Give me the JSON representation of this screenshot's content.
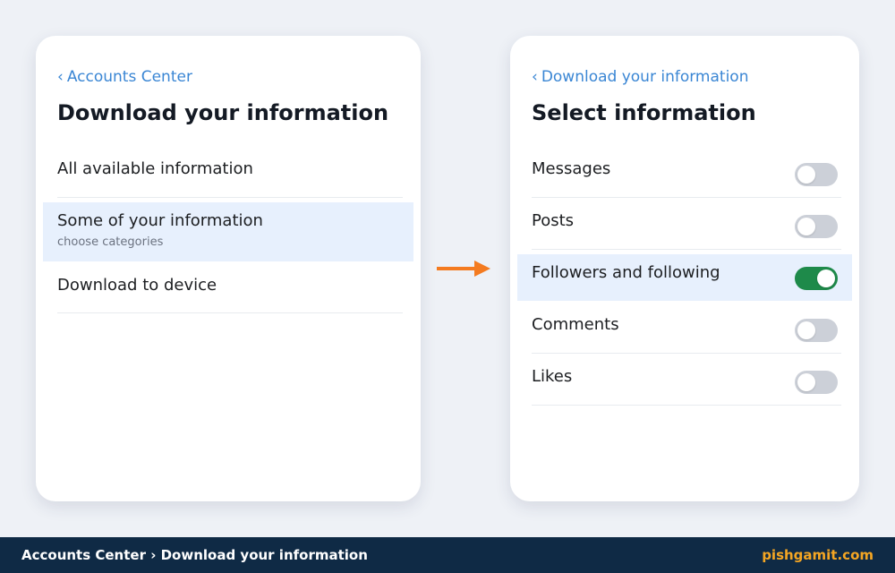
{
  "left_panel": {
    "back_label": "Accounts Center",
    "title": "Download your information",
    "options": [
      {
        "label": "All available information",
        "sub": "",
        "selected": false
      },
      {
        "label": "Some of your information",
        "sub": "choose categories",
        "selected": true
      },
      {
        "label": "Download to device",
        "sub": "",
        "selected": false
      }
    ]
  },
  "right_panel": {
    "back_label": "Download your information",
    "title": "Select information",
    "items": [
      {
        "label": "Messages",
        "enabled": false
      },
      {
        "label": "Posts",
        "enabled": false
      },
      {
        "label": "Followers and following",
        "enabled": true
      },
      {
        "label": "Comments",
        "enabled": false
      },
      {
        "label": "Likes",
        "enabled": false
      }
    ]
  },
  "arrow": {
    "icon": "arrow-right-icon",
    "color": "#f47b20"
  },
  "footer": {
    "breadcrumb": "Accounts Center › Download your information",
    "brand": "pishgamit.com"
  },
  "colors": {
    "accent": "#3a86d4",
    "selected_bg": "#e7f0fd",
    "toggle_on": "#1e8a4a",
    "toggle_off": "#ccd0d8",
    "footer_bg": "#0f2a45",
    "brand": "#f5a623"
  }
}
